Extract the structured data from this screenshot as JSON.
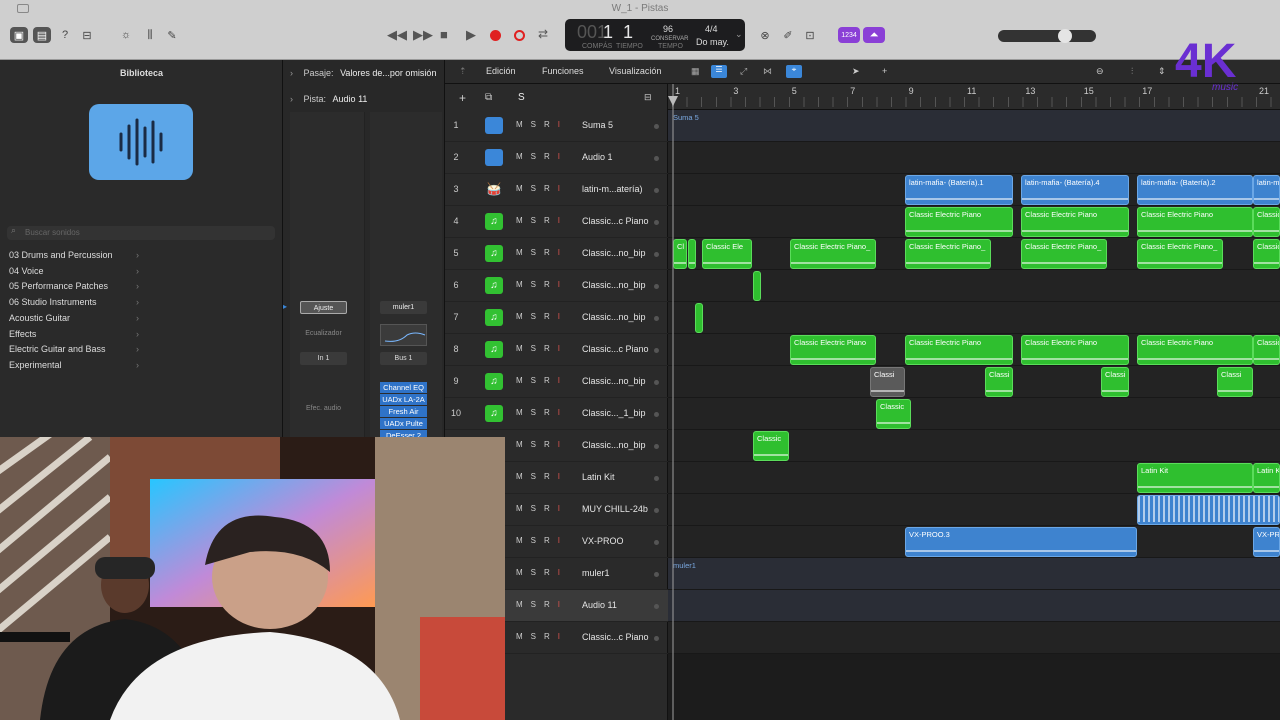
{
  "window": {
    "title": "W_1 - Pistas"
  },
  "transport": {
    "rewind_icon": "rewind-icon",
    "forward_icon": "fast-forward-icon",
    "lcd": {
      "position_a": "001",
      "position_b": "1",
      "position_c": "1",
      "bar_label": "COMPÁS",
      "beat_label": "TIEMPO",
      "tempo": "96",
      "tempo_mode": "CONSERVAR",
      "tempo_label": "TEMPO",
      "signature": "4/4",
      "key": "Do may."
    },
    "counter_badge": "1234"
  },
  "library": {
    "title": "Biblioteca",
    "search_placeholder": "Buscar sonidos",
    "items": [
      "03 Drums and Percussion",
      "04 Voice",
      "05 Performance Patches",
      "06 Studio Instruments",
      "Acoustic Guitar",
      "Effects",
      "Electric Guitar and Bass",
      "Experimental"
    ]
  },
  "inspector": {
    "region_label": "Pasaje:",
    "region_value": "Valores de...por omisión",
    "track_label": "Pista:",
    "track_value": "Audio 11",
    "strip1": {
      "setting": "Ajuste",
      "eq": "Ecualizador",
      "input": "In 1",
      "effects": "Efec. audio"
    },
    "strip2": {
      "name": "muler1",
      "output": "Bus 1",
      "plugins": [
        "Channel EQ",
        "UADx LA-2A",
        "Fresh Air",
        "UADx Pulte",
        "DeEsser 2"
      ]
    }
  },
  "track_toolbar": {
    "menus": [
      "Edición",
      "Funciones",
      "Visualización"
    ],
    "add_button": "+",
    "s_button": "S"
  },
  "ruler": {
    "bars": [
      "1",
      "3",
      "5",
      "7",
      "9",
      "11",
      "13",
      "15",
      "17",
      "21"
    ]
  },
  "tracks": [
    {
      "num": "1",
      "name": "Suma 5",
      "icon": "blue"
    },
    {
      "num": "2",
      "name": "Audio 1",
      "icon": "blue"
    },
    {
      "num": "3",
      "name": "latin-m...atería)",
      "icon": "drum"
    },
    {
      "num": "4",
      "name": "Classic...c Piano",
      "icon": "green"
    },
    {
      "num": "5",
      "name": "Classic...no_bip",
      "icon": "green"
    },
    {
      "num": "6",
      "name": "Classic...no_bip",
      "icon": "green"
    },
    {
      "num": "7",
      "name": "Classic...no_bip",
      "icon": "green"
    },
    {
      "num": "8",
      "name": "Classic...c Piano",
      "icon": "green"
    },
    {
      "num": "9",
      "name": "Classic...no_bip",
      "icon": "green"
    },
    {
      "num": "10",
      "name": "Classic..._1_bip",
      "icon": "green"
    },
    {
      "num": "",
      "name": "Classic...no_bip",
      "icon": ""
    },
    {
      "num": "",
      "name": "Latin Kit",
      "icon": ""
    },
    {
      "num": "",
      "name": "MUY CHILL-24b",
      "icon": ""
    },
    {
      "num": "",
      "name": "VX-PROO",
      "icon": ""
    },
    {
      "num": "",
      "name": "muler1",
      "icon": ""
    },
    {
      "num": "",
      "name": "Audio 11",
      "icon": ""
    },
    {
      "num": "",
      "name": "Classic...c Piano",
      "icon": ""
    }
  ],
  "regions": {
    "suma": "Suma 5",
    "latin1": "latin-mafia- (Batería).1",
    "latin4": "latin-mafia- (Batería).4",
    "latin2": "latin-mafia- (Batería).2",
    "latin_cut": "latin-m",
    "cep": "Classic Electric Piano",
    "cep_us": "Classic Electric Piano_",
    "cl": "Cl",
    "cle": "Classic Ele",
    "classi": "Classi",
    "classic": "Classic",
    "latin_kit": "Latin Kit",
    "latin_kit_cut": "Latin Ki",
    "vx": "VX-PROO.3",
    "vx_cut": "VX-PR",
    "muler": "muler1"
  },
  "logo": {
    "main": "4K",
    "sub": "music"
  }
}
